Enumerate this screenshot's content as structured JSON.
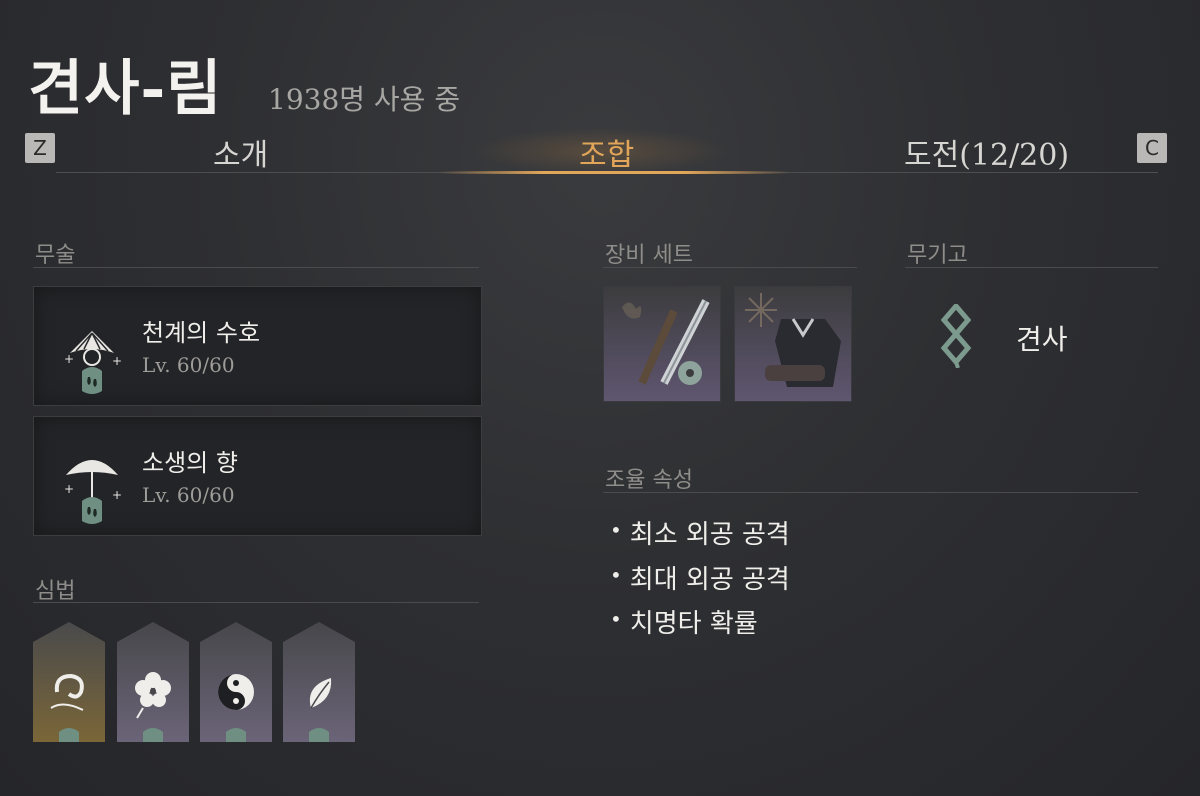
{
  "header": {
    "title": "견사-림",
    "users": "1938명 사용 중"
  },
  "tabs": {
    "prev_key": "Z",
    "next_key": "C",
    "items": [
      {
        "label": "소개"
      },
      {
        "label": "조합"
      },
      {
        "label": "도전(12/20)"
      }
    ]
  },
  "martial": {
    "title": "무술",
    "skills": [
      {
        "name": "천계의 수호",
        "level": "Lv. 60/60",
        "icon": "fan-icon"
      },
      {
        "name": "소생의 향",
        "level": "Lv. 60/60",
        "icon": "umbrella-icon"
      }
    ]
  },
  "heart": {
    "title": "심법",
    "items": [
      {
        "icon": "swirl-leaf-icon"
      },
      {
        "icon": "flower-icon"
      },
      {
        "icon": "yin-yang-icon"
      },
      {
        "icon": "leaf-icon"
      }
    ]
  },
  "equipment": {
    "title": "장비 세트",
    "items": [
      {
        "icon": "sword-set-icon"
      },
      {
        "icon": "armor-set-icon"
      }
    ]
  },
  "weapon": {
    "title": "무기고",
    "name": "견사",
    "icon": "weapon-rune-icon"
  },
  "attributes": {
    "title": "조율 속성",
    "items": [
      "최소 외공 공격",
      "최대 외공 공격",
      "치명타 확률"
    ]
  },
  "colors": {
    "accent": "#e2a65a",
    "background": "#2e2f32",
    "jade": "#7c9a8e"
  }
}
